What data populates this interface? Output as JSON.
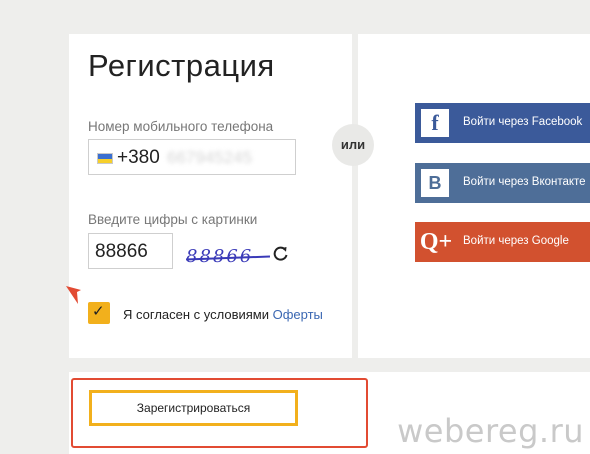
{
  "form": {
    "title": "Регистрация",
    "phone_label": "Номер мобильного телефона",
    "phone_prefix": "+380",
    "phone_hidden": "667945245",
    "captcha_label": "Введите цифры с картинки",
    "captcha_value": "88866",
    "captcha_image_text": "88866",
    "agree_text": "Я согласен с условиями ",
    "offer_link": "Оферты",
    "agree_checked": true,
    "register_label": "Зарегистрироваться"
  },
  "divider": {
    "label": "или"
  },
  "social": [
    {
      "icon": "facebook-icon",
      "icon_text": "f",
      "label": "Войти через Facebook",
      "color": "#3b5a9a"
    },
    {
      "icon": "vk-icon",
      "icon_text": "B",
      "label": "Войти через Вконтакте",
      "color": "#4e6e98"
    },
    {
      "icon": "google-plus-icon",
      "icon_text": "Q+",
      "label": "Войти через Google",
      "color": "#d2512f"
    }
  ],
  "watermark": "webereg.ru",
  "colors": {
    "accent": "#f2b01c",
    "highlight": "#e24b33",
    "link": "#3a67b2"
  }
}
